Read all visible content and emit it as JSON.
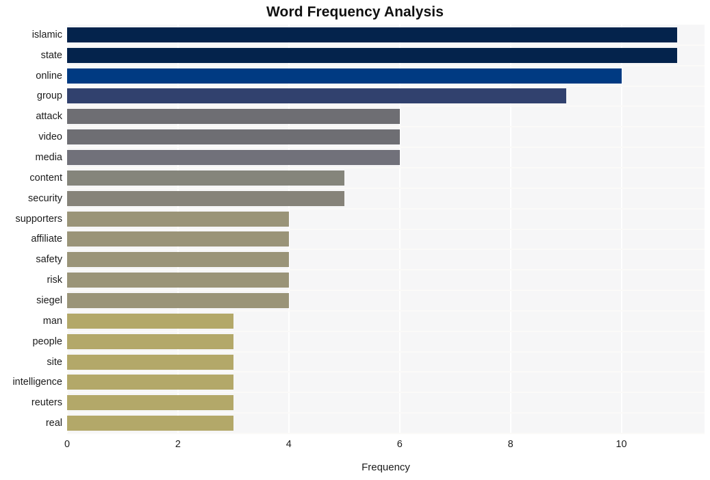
{
  "chart_data": {
    "type": "bar",
    "orientation": "horizontal",
    "title": "Word Frequency Analysis",
    "xlabel": "Frequency",
    "ylabel": "",
    "xlim": [
      0,
      11.5
    ],
    "xticks": [
      0,
      2,
      4,
      6,
      8,
      10
    ],
    "xtick_labels": [
      "0",
      "2",
      "4",
      "6",
      "8",
      "10"
    ],
    "grid": true,
    "grid_axis": "x",
    "legend": null,
    "categories": [
      "islamic",
      "state",
      "online",
      "group",
      "attack",
      "video",
      "media",
      "content",
      "security",
      "supporters",
      "affiliate",
      "safety",
      "risk",
      "siegel",
      "man",
      "people",
      "site",
      "intelligence",
      "reuters",
      "real"
    ],
    "values": [
      11,
      11,
      10,
      9,
      6,
      6,
      6,
      5,
      5,
      4,
      4,
      4,
      4,
      4,
      3,
      3,
      3,
      3,
      3,
      3
    ],
    "bar_colors": [
      "#04234c",
      "#04234c",
      "#003a82",
      "#31416e",
      "#6e6e73",
      "#6e6e73",
      "#71717a",
      "#85857b",
      "#868379",
      "#9a9478",
      "#9a9478",
      "#9a9478",
      "#9a9478",
      "#9a9478",
      "#b3a869",
      "#b3a869",
      "#b3a869",
      "#b3a869",
      "#b3a869",
      "#b3a869"
    ],
    "plot_background": "#f6f6f7",
    "figure_background": "#ffffff"
  }
}
